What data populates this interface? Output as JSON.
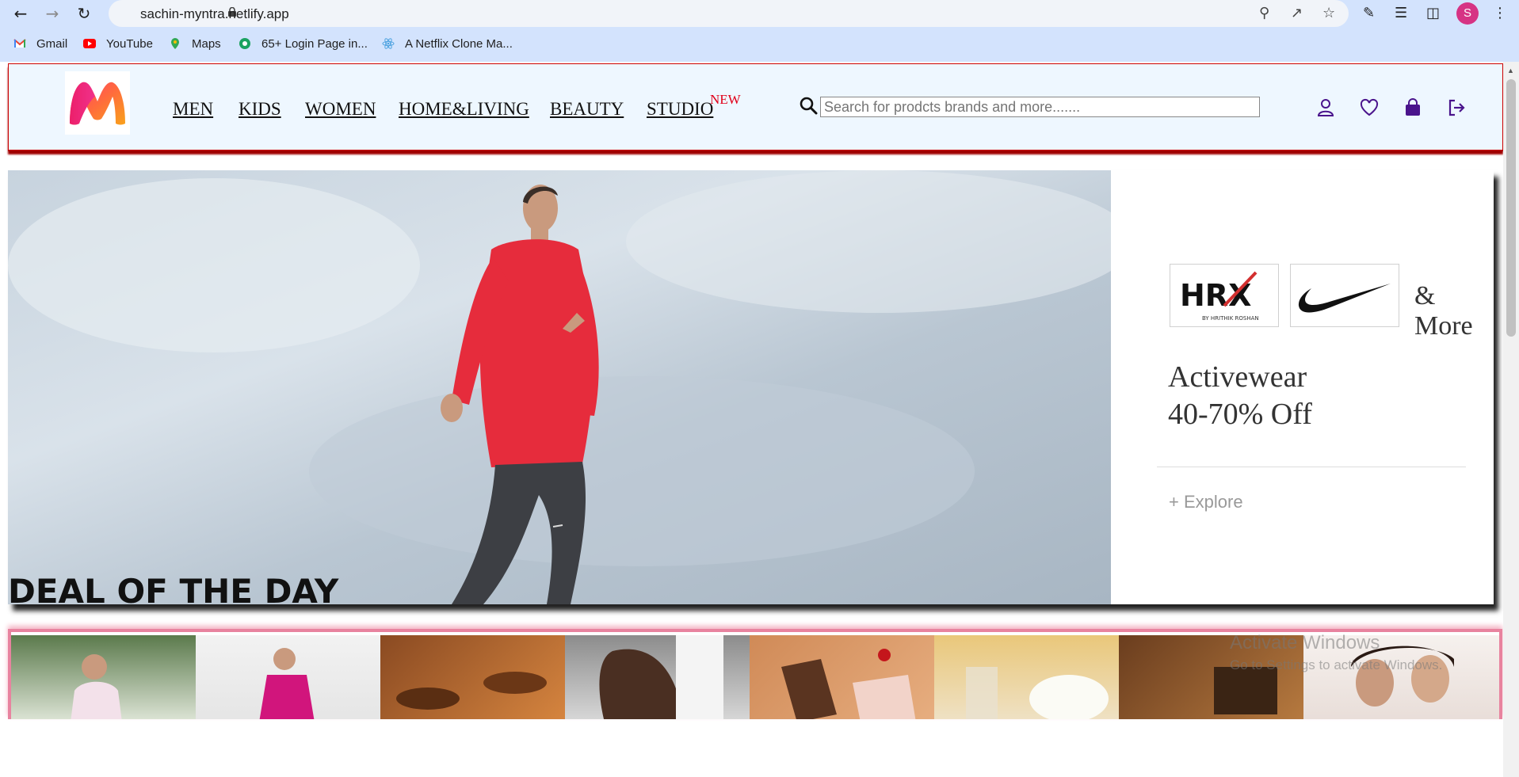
{
  "browser": {
    "url": "sachin-myntra.netlify.app",
    "profile_initial": "S",
    "bookmarks": [
      {
        "label": "Gmail",
        "icon": "gmail-icon"
      },
      {
        "label": "YouTube",
        "icon": "youtube-icon"
      },
      {
        "label": "Maps",
        "icon": "maps-icon"
      },
      {
        "label": "65+ Login Page in...",
        "icon": "site-icon"
      },
      {
        "label": "A Netflix Clone Ma...",
        "icon": "react-icon"
      }
    ]
  },
  "header": {
    "logo": "myntra-logo",
    "nav": [
      {
        "label": "MEN"
      },
      {
        "label": "KIDS"
      },
      {
        "label": "WOMEN"
      },
      {
        "label": "HOME&LIVING"
      },
      {
        "label": "BEAUTY"
      },
      {
        "label": "STUDIO"
      }
    ],
    "studio_badge": "NEW",
    "search_placeholder": "Search for prodcts brands and more.......",
    "icons": [
      "profile-icon",
      "wishlist-icon",
      "bag-icon",
      "logout-icon"
    ],
    "accent_color": "#6a1b9a"
  },
  "hero": {
    "brands": [
      "HRX",
      "Nike"
    ],
    "hrx_tagline": "BY HRITHIK ROSHAN",
    "more_text": "& More",
    "offer_line1": "Activewear",
    "offer_line2": "40-70% Off",
    "explore": "+ Explore"
  },
  "deals": {
    "title": "DEAL OF THE DAY"
  },
  "watermark": {
    "line1": "Activate Windows",
    "line2": "Go to Settings to activate Windows."
  }
}
